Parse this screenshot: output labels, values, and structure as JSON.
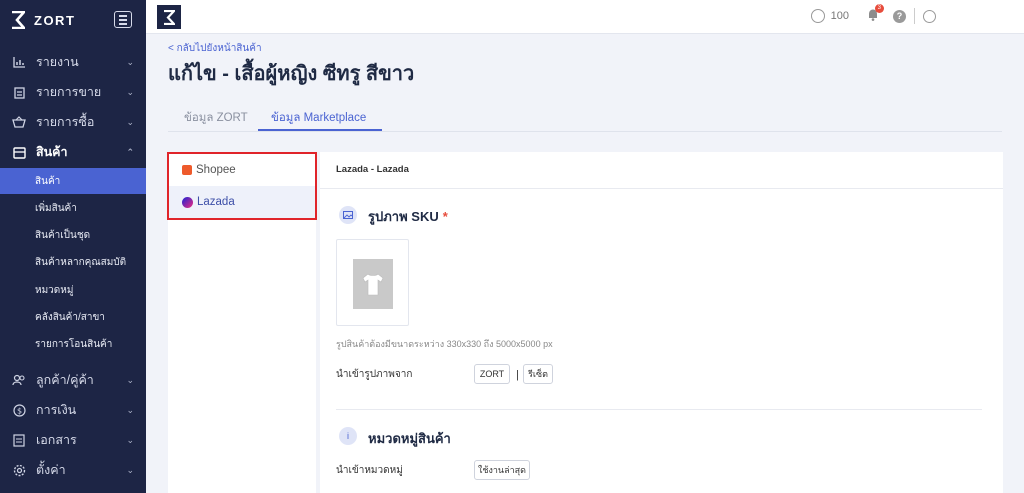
{
  "brand": {
    "name": "ZORT"
  },
  "sidebar": {
    "items": [
      {
        "label": "รายงาน",
        "icon": "chart-icon"
      },
      {
        "label": "รายการขาย",
        "icon": "clipboard-icon"
      },
      {
        "label": "รายการซื้อ",
        "icon": "basket-icon"
      },
      {
        "label": "สินค้า",
        "icon": "box-icon"
      },
      {
        "label": "ลูกค้า/คู่ค้า",
        "icon": "users-icon"
      },
      {
        "label": "การเงิน",
        "icon": "coin-icon"
      },
      {
        "label": "เอกสาร",
        "icon": "document-icon"
      },
      {
        "label": "ตั้งค่า",
        "icon": "gear-icon"
      }
    ],
    "sub_items": [
      {
        "label": "สินค้า"
      },
      {
        "label": "เพิ่มสินค้า"
      },
      {
        "label": "สินค้าเป็นชุด"
      },
      {
        "label": "สินค้าหลากคุณสมบัติ"
      },
      {
        "label": "หมวดหมู่"
      },
      {
        "label": "คลังสินค้า/สาขา"
      },
      {
        "label": "รายการโอนสินค้า"
      }
    ]
  },
  "topbar": {
    "credits": "100",
    "notification_count": "3"
  },
  "page": {
    "back_link": "< กลับไปยังหน้าสินค้า",
    "title": "แก้ไข - เสื้อผู้หญิง ซีทรู สีขาว"
  },
  "tabs": [
    {
      "label": "ข้อมูล ZORT"
    },
    {
      "label": "ข้อมูล Marketplace"
    }
  ],
  "channels": [
    {
      "label": "Shopee"
    },
    {
      "label": "Lazada"
    }
  ],
  "card": {
    "header": "Lazada - Lazada",
    "sku_section": {
      "title": "รูปภาพ SKU",
      "required_mark": "*",
      "hint": "รูปสินค้าต้องมีขนาดระหว่าง 330x330 ถึง 5000x5000 px",
      "import_label": "นำเข้ารูปภาพจาก",
      "zort_button": "ZORT",
      "separator": "|",
      "reset_button": "รีเซ็ต"
    },
    "category_section": {
      "title": "หมวดหมู่สินค้า",
      "import_label": "นำเข้าหมวดหมู่",
      "latest_button": "ใช้งานล่าสุด"
    }
  },
  "colors": {
    "sidebar_bg": "#1d2545",
    "accent": "#4a63d2",
    "highlight": "#e0242a"
  }
}
